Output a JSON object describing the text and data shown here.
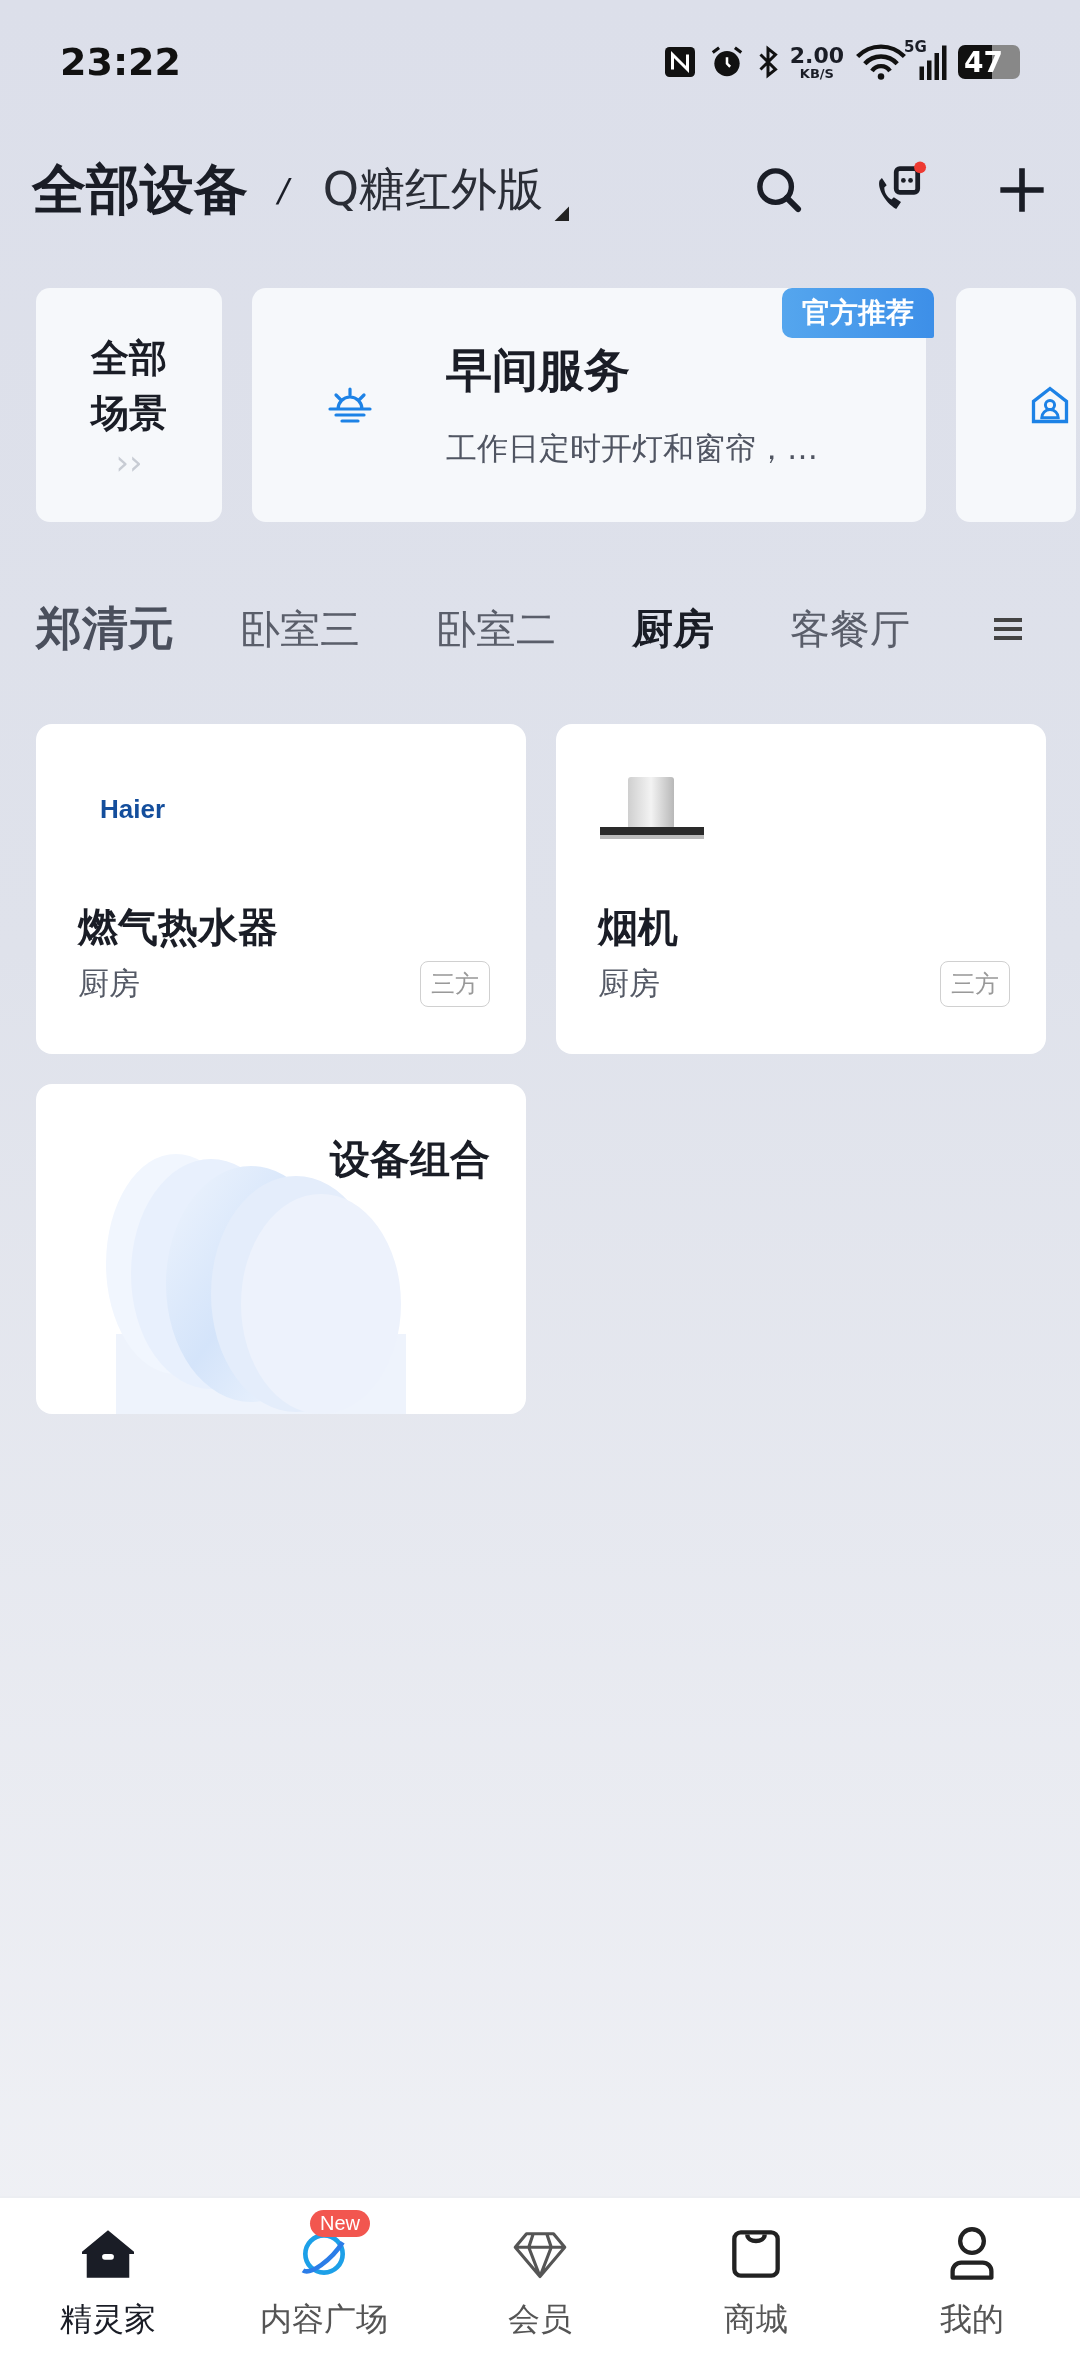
{
  "status_bar": {
    "time": "23:22",
    "speed_value": "2.00",
    "speed_unit": "KB/S",
    "network": "5G",
    "battery": "47"
  },
  "header": {
    "title": "全部设备",
    "separator": "/",
    "home": "Q糖红外版"
  },
  "scenes": [
    {
      "kind": "all",
      "label": "全部场景",
      "arrow": "››"
    },
    {
      "kind": "scene",
      "title": "早间服务",
      "description": "工作日定时开灯和窗帘，…",
      "badge": "官方推荐"
    },
    {
      "kind": "partial"
    }
  ],
  "rooms": {
    "home_name": "郑清元",
    "tabs": [
      {
        "label": "卧室三",
        "selected": false
      },
      {
        "label": "卧室二",
        "selected": false
      },
      {
        "label": "厨房",
        "selected": true
      },
      {
        "label": "客餐厅",
        "selected": false
      }
    ]
  },
  "devices": [
    {
      "kind": "haier",
      "logo": "Haier",
      "name": "燃气热水器",
      "room": "厨房",
      "tag": "三方"
    },
    {
      "kind": "hood",
      "name": "烟机",
      "room": "厨房",
      "tag": "三方"
    },
    {
      "kind": "group",
      "name": "设备组合"
    }
  ],
  "nav": [
    {
      "label": "精灵家",
      "kind": "home",
      "selected": true
    },
    {
      "label": "内容广场",
      "kind": "planet",
      "selected": false,
      "badge": "New"
    },
    {
      "label": "会员",
      "kind": "diamond",
      "selected": false
    },
    {
      "label": "商城",
      "kind": "bag",
      "selected": false
    },
    {
      "label": "我的",
      "kind": "person",
      "selected": false
    }
  ]
}
